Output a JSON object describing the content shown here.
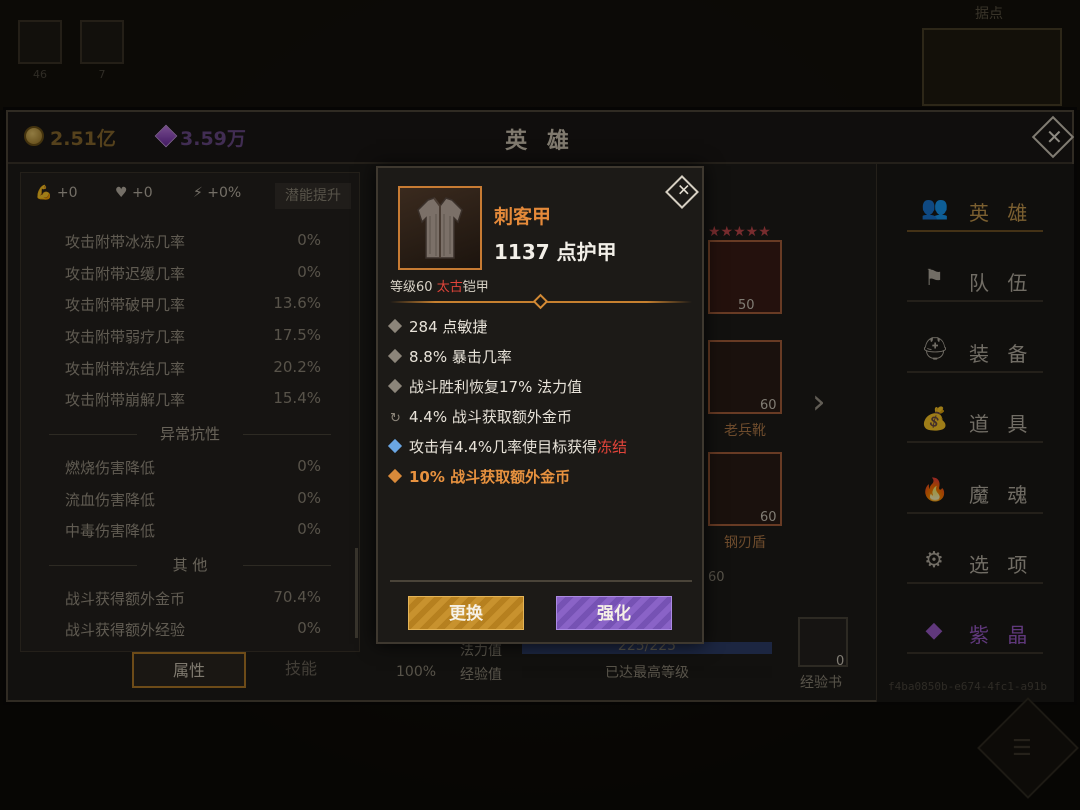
{
  "background": {
    "slot_counts": [
      "46",
      "7"
    ],
    "map_title": "据点"
  },
  "header": {
    "title": "英 雄",
    "gold": "2.51亿",
    "gems": "3.59万"
  },
  "potential": {
    "strength": "+0",
    "vitality": "+0",
    "agility": "+0%",
    "button": "潜能提升"
  },
  "stats": {
    "attack_effects": [
      {
        "label": "攻击附带冰冻几率",
        "value": "0%"
      },
      {
        "label": "攻击附带迟缓几率",
        "value": "0%"
      },
      {
        "label": "攻击附带破甲几率",
        "value": "13.6%"
      },
      {
        "label": "攻击附带弱疗几率",
        "value": "17.5%"
      },
      {
        "label": "攻击附带冻结几率",
        "value": "20.2%"
      },
      {
        "label": "攻击附带崩解几率",
        "value": "15.4%"
      }
    ],
    "section_resist": "异常抗性",
    "resists": [
      {
        "label": "燃烧伤害降低",
        "value": "0%"
      },
      {
        "label": "流血伤害降低",
        "value": "0%"
      },
      {
        "label": "中毒伤害降低",
        "value": "0%"
      }
    ],
    "section_other": "其 他",
    "others": [
      {
        "label": "战斗获得额外金币",
        "value": "70.4%"
      },
      {
        "label": "战斗获得额外经验",
        "value": "0%"
      }
    ]
  },
  "left_tabs": {
    "attributes": "属性",
    "skills": "技能"
  },
  "hero": {
    "level": "50",
    "boots_level": "60",
    "boots_name": "老兵靴",
    "shield_level": "60",
    "shield_name": "钢刃盾",
    "exp_level_fragment": "60",
    "percent": "100%",
    "mana_label": "法力值",
    "mana_value": "225/225",
    "exp_label": "经验值",
    "exp_value": "已达最高等级",
    "book_label": "经验书",
    "book_count": "0"
  },
  "nav": [
    {
      "label": "英 雄",
      "icon": "hero-icon",
      "glyph": "👥",
      "active": true
    },
    {
      "label": "队 伍",
      "icon": "flag-icon",
      "glyph": "⚑"
    },
    {
      "label": "装 备",
      "icon": "helmet-icon",
      "glyph": "⛑"
    },
    {
      "label": "道 具",
      "icon": "bag-icon",
      "glyph": "💰"
    },
    {
      "label": "魔 魂",
      "icon": "flame-icon",
      "glyph": "🔥"
    },
    {
      "label": "选 项",
      "icon": "gear-icon",
      "glyph": "⚙"
    },
    {
      "label": "紫 晶",
      "icon": "crystal-icon",
      "glyph": "◆"
    }
  ],
  "uid": "f4ba0850b-e674-4fc1-a91b",
  "item": {
    "name": "刺客甲",
    "armor": "1137 点护甲",
    "level_prefix": "等级60 ",
    "quality": "太古",
    "type": "铠甲",
    "attributes": [
      {
        "text": "284 点敏捷",
        "kind": "normal"
      },
      {
        "text": "8.8% 暴击几率",
        "kind": "normal"
      },
      {
        "text": "战斗胜利恢复17% 法力值",
        "kind": "normal"
      },
      {
        "text": "4.4% 战斗获取额外金币",
        "kind": "cycle"
      },
      {
        "text": "攻击有4.4%几率使目标获得",
        "highlight": "冻结",
        "kind": "blue"
      },
      {
        "text": "10% 战斗获取额外金币",
        "kind": "orange"
      }
    ],
    "btn_replace": "更换",
    "btn_enhance": "强化"
  },
  "colors": {
    "accent_gold": "#c79a4e",
    "item_orange": "#e58a3a",
    "quality_red": "#e0443a",
    "gem_purple": "#9b5bc8"
  }
}
